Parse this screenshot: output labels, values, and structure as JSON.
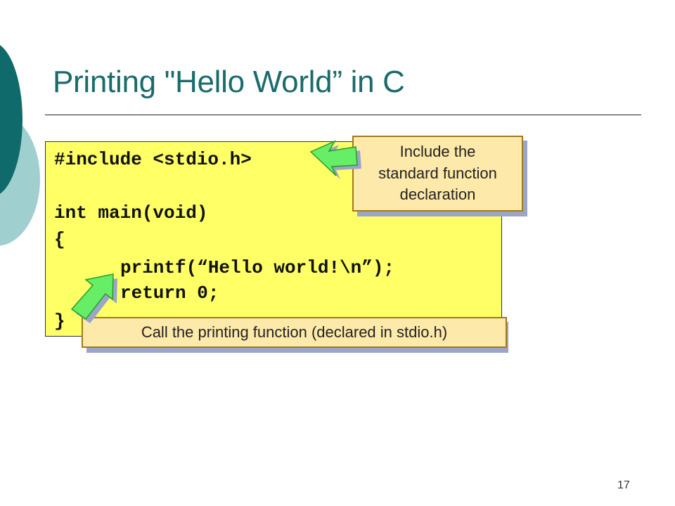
{
  "slide": {
    "title": "Printing \"Hello World” in C",
    "page_number": "17"
  },
  "code": {
    "lines": [
      "#include <stdio.h>",
      "int main(void)",
      "{",
      "printf(“Hello world!\\n”);",
      "return 0;",
      "}"
    ]
  },
  "callouts": {
    "include": {
      "line1": "Include the",
      "line2": "standard function",
      "line3": "declaration"
    },
    "printf": {
      "text": "Call the printing function (declared in stdio.h)"
    }
  },
  "colors": {
    "title": "#1a6b6b",
    "code_background": "#ffff66",
    "callout_fill": "#fde9a9",
    "arrow_fill": "#66ee66",
    "decor_dark": "#0f6b6b",
    "decor_light": "#9fcfcf"
  }
}
